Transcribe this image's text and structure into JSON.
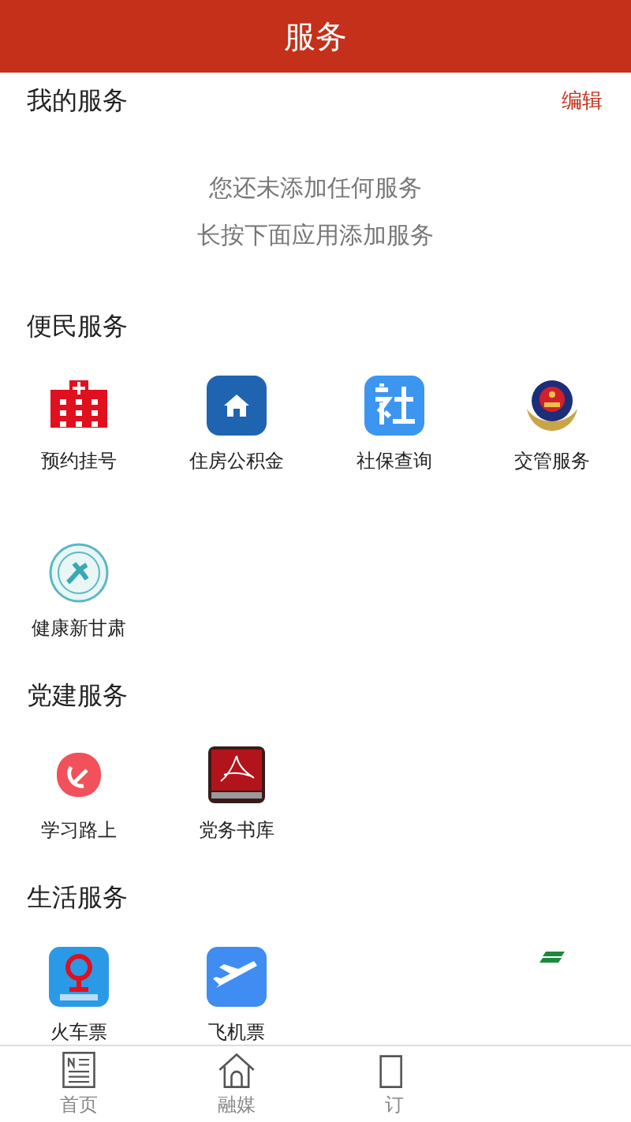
{
  "header": {
    "title": "服务"
  },
  "my_services": {
    "title": "我的服务",
    "edit": "编辑",
    "empty_lines": [
      "您还未添加任何服务",
      "长按下面应用添加服务"
    ]
  },
  "sections": [
    {
      "title": "便民服务",
      "items": [
        {
          "label": "预约挂号"
        },
        {
          "label": "住房公积金"
        },
        {
          "label": "社保查询"
        },
        {
          "label": "交管服务"
        },
        {
          "label": "健康新甘肃"
        }
      ]
    },
    {
      "title": "党建服务",
      "items": [
        {
          "label": "学习路上"
        },
        {
          "label": "党务书库"
        }
      ]
    },
    {
      "title": "生活服务",
      "items": [
        {
          "label": "火车票"
        },
        {
          "label": "飞机票"
        }
      ]
    }
  ],
  "tabbar": [
    {
      "label": "首页"
    },
    {
      "label": "融媒"
    },
    {
      "label": "订"
    }
  ]
}
